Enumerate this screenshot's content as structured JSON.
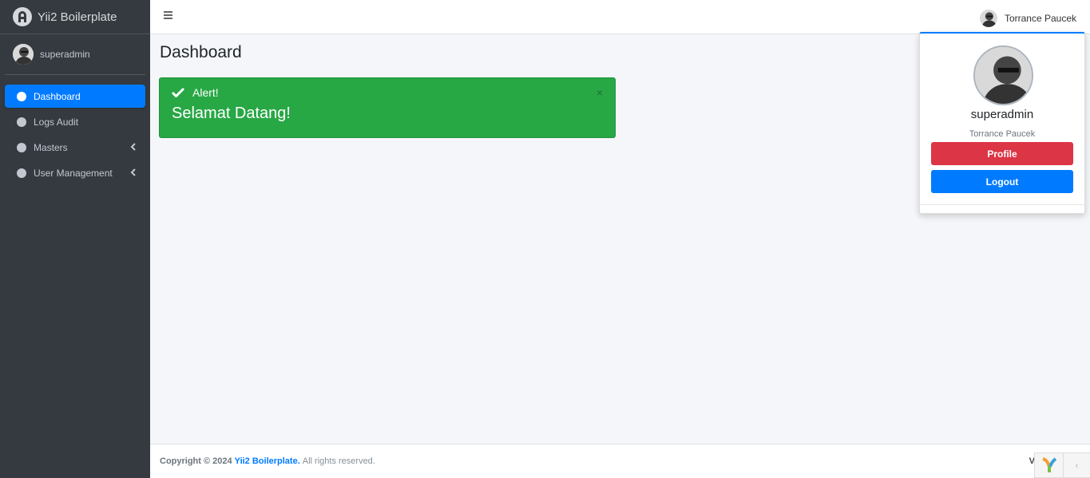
{
  "brand": {
    "name": "Yii2 Boilerplate"
  },
  "sidebar": {
    "username": "superadmin",
    "items": [
      {
        "label": "Dashboard",
        "active": true
      },
      {
        "label": "Logs Audit",
        "active": false
      },
      {
        "label": "Masters",
        "active": false,
        "has_children": true
      },
      {
        "label": "User Management",
        "active": false,
        "has_children": true
      }
    ]
  },
  "header": {
    "user_name": "Torrance Paucek"
  },
  "main": {
    "title": "Dashboard",
    "alert": {
      "title": "Alert!",
      "message": "Selamat Datang!",
      "close": "×"
    }
  },
  "dropdown": {
    "name": "superadmin",
    "full_name": "Torrance Paucek",
    "profile_label": "Profile",
    "logout_label": "Logout"
  },
  "footer": {
    "copyright": "Copyright © 2024",
    "brand_link": "Yii2 Boilerplate.",
    "rights": "All rights reserved.",
    "version": "V"
  },
  "colors": {
    "sidebar": "#343a40",
    "primary": "#007bff",
    "success": "#28a745",
    "danger": "#dc3545"
  }
}
